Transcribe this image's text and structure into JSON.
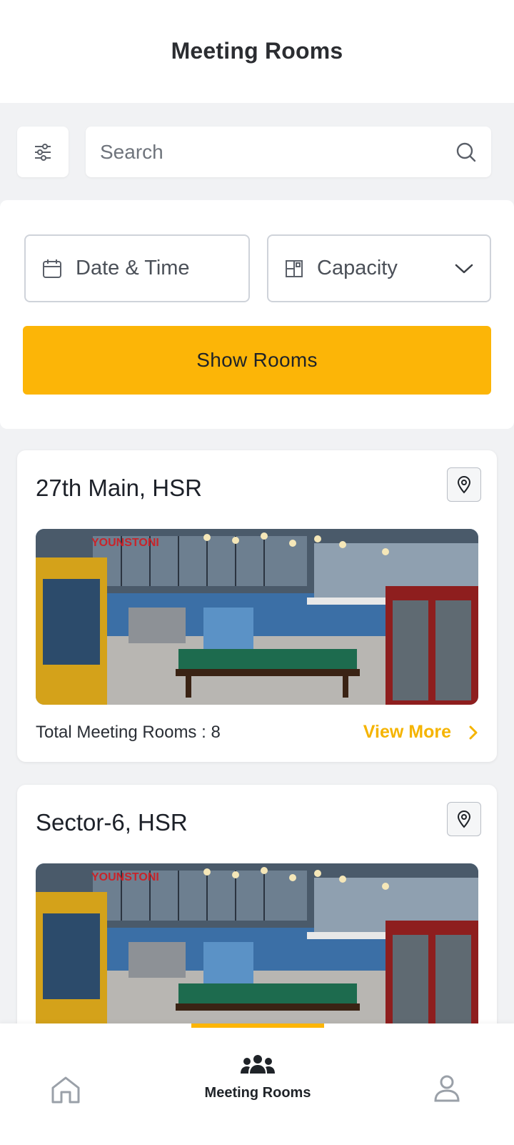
{
  "header": {
    "title": "Meeting Rooms"
  },
  "search": {
    "placeholder": "Search"
  },
  "filters": {
    "date_label": "Date & Time",
    "capacity_label": "Capacity",
    "show_button": "Show Rooms"
  },
  "locations": [
    {
      "name": "27th Main, HSR",
      "total_rooms_label": "Total Meeting Rooms : 8",
      "view_more": "View More"
    },
    {
      "name": "Sector-6, HSR"
    }
  ],
  "bottom_nav": {
    "items": [
      {
        "icon": "home-icon",
        "label": ""
      },
      {
        "icon": "people-group-icon",
        "label": "Meeting Rooms",
        "active": true
      },
      {
        "icon": "profile-icon",
        "label": ""
      }
    ]
  },
  "colors": {
    "accent": "#fcb507",
    "accent_text": "#f5b400",
    "background": "#f1f2f4"
  }
}
